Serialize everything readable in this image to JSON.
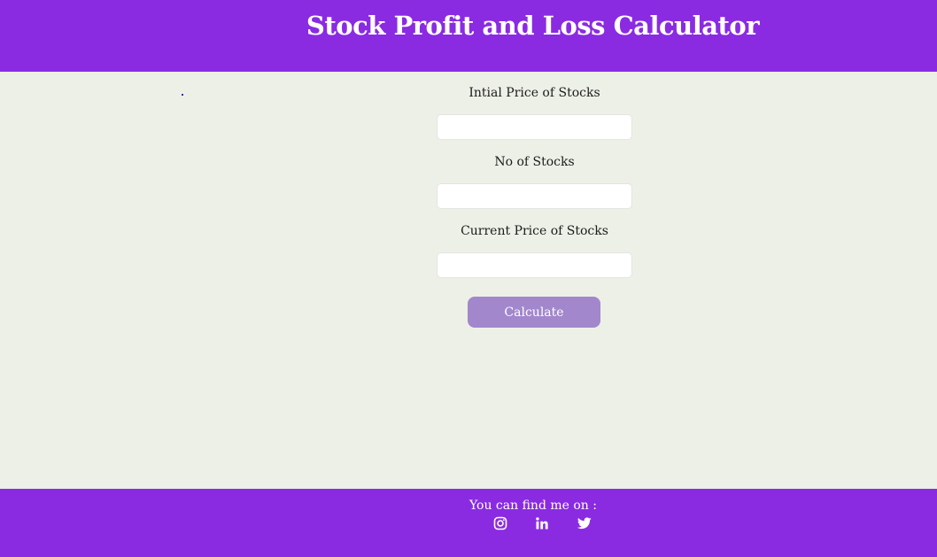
{
  "header": {
    "title": "Stock Profit and Loss Calculator"
  },
  "form": {
    "initial_price_label": "Intial Price of Stocks",
    "initial_price_value": "",
    "quantity_label": "No of Stocks",
    "quantity_value": "",
    "current_price_label": "Current Price of Stocks",
    "current_price_value": "",
    "calculate_label": "Calculate"
  },
  "footer": {
    "title": "You can find me on :",
    "links": [
      {
        "icon": "instagram-icon"
      },
      {
        "icon": "linkedin-icon"
      },
      {
        "icon": "twitter-icon"
      }
    ]
  },
  "colors": {
    "brand": "#8a2be2",
    "background": "#edf0e6",
    "button": "#a287cc"
  }
}
